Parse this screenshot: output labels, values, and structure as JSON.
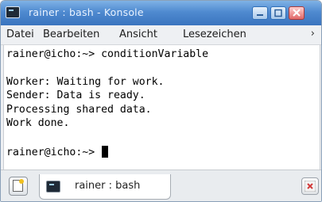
{
  "window": {
    "title": "rainer : bash - Konsole"
  },
  "menubar": {
    "items": [
      "Datei",
      "Bearbeiten",
      "Ansicht",
      "Lesezeichen"
    ],
    "more": "›"
  },
  "terminal": {
    "lines": [
      "rainer@icho:~> conditionVariable",
      "",
      "Worker: Waiting for work.",
      "Sender: Data is ready.",
      "Processing shared data.",
      "Work done.",
      "",
      "rainer@icho:~> "
    ]
  },
  "tabbar": {
    "tab_label": "rainer : bash"
  },
  "icons": {
    "app": "terminal-icon",
    "minimize": "minimize-icon",
    "maximize": "maximize-icon",
    "close": "close-icon",
    "new_tab": "new-tab-icon",
    "tab": "terminal-icon",
    "close_tab": "close-tab-icon"
  },
  "colors": {
    "titlebar": "#4f8ad0",
    "terminal_bg": "#ffffff",
    "terminal_fg": "#000000"
  }
}
